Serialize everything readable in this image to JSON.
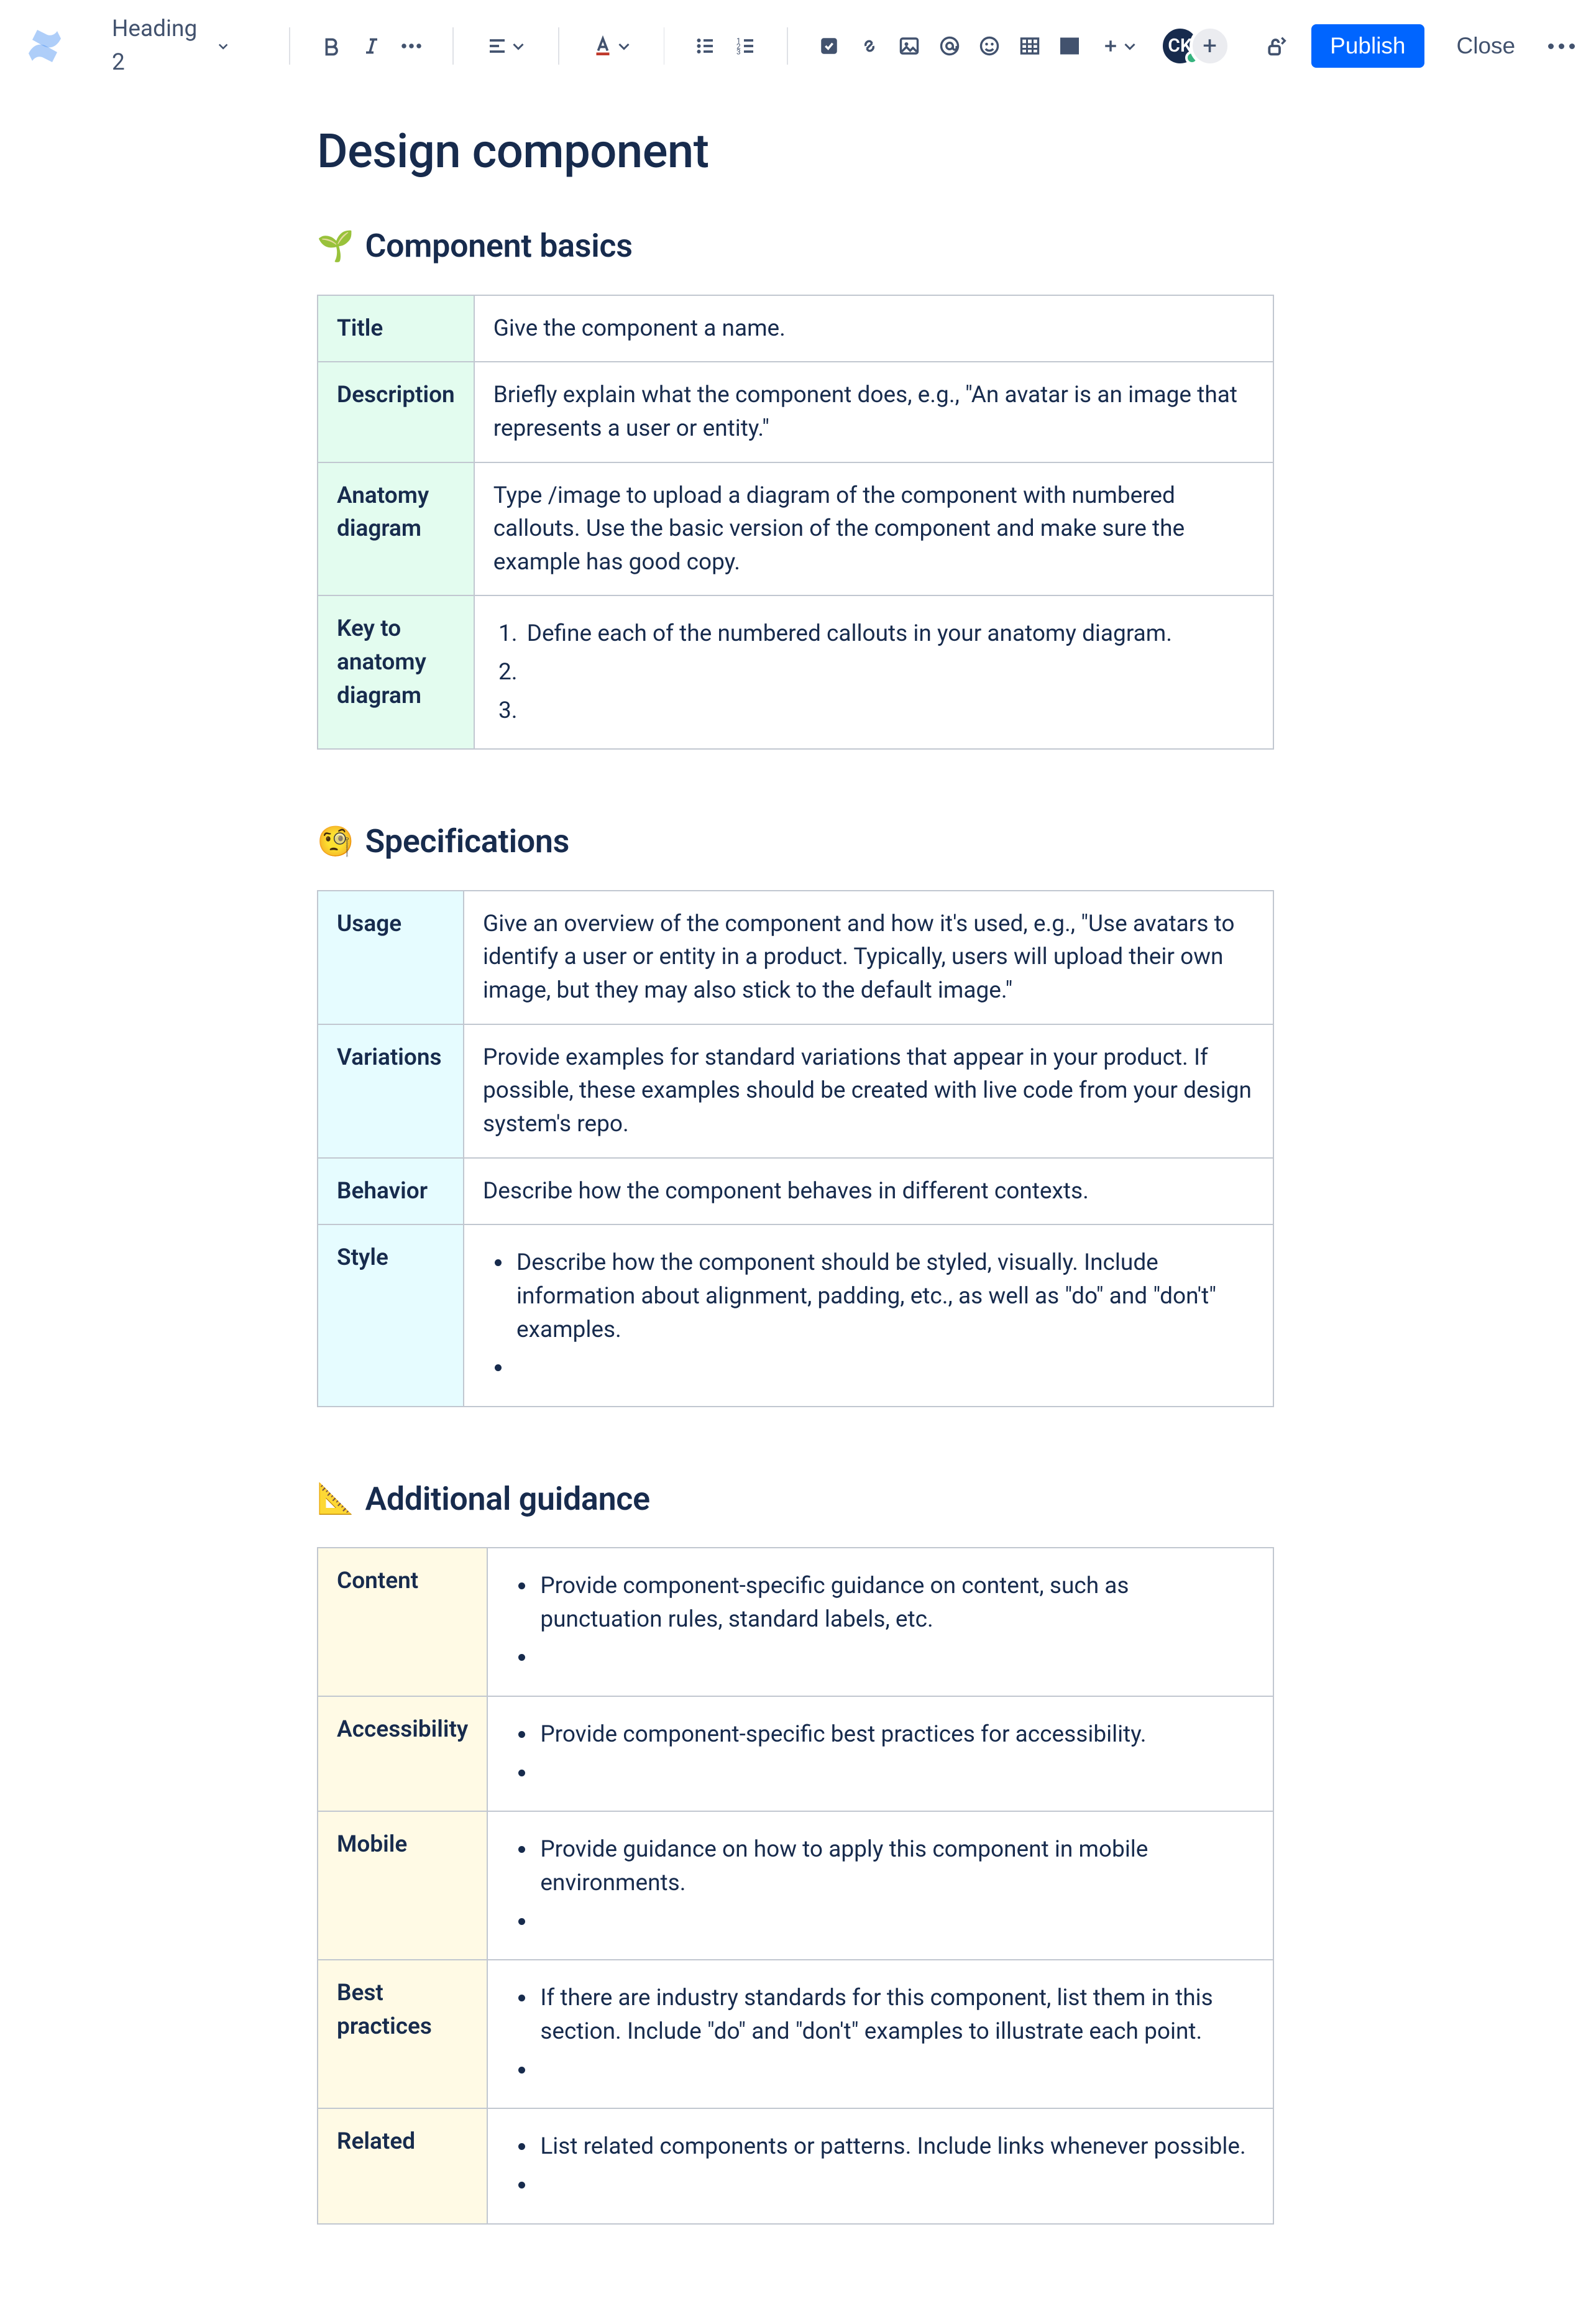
{
  "toolbar": {
    "text_style": "Heading 2",
    "publish_label": "Publish",
    "close_label": "Close",
    "avatar_initials": "CK"
  },
  "page": {
    "title": "Design component",
    "sections": {
      "basics": {
        "emoji": "🌱",
        "heading": "Component basics",
        "rows": {
          "title_label": "Title",
          "title_val": "Give the component a name.",
          "desc_label": "Description",
          "desc_val": "Briefly explain what the component does, e.g., \"An avatar is an image that represents a user or entity.\"",
          "anatomy_label": "Anatomy diagram",
          "anatomy_val": "Type /image to upload a diagram of the component with numbered callouts. Use the basic version of the component and make sure the example has good copy.",
          "key_label": "Key to anatomy diagram",
          "key_item1": "Define each of the numbered callouts in your anatomy diagram.",
          "key_item2": "",
          "key_item3": ""
        }
      },
      "specs": {
        "emoji": "🧐",
        "heading": "Specifications",
        "rows": {
          "usage_label": "Usage",
          "usage_val": "Give an overview of the component and how it's used, e.g., \"Use avatars to identify a user or entity in a product. Typically, users will upload their own image, but they may also stick to the default image.\"",
          "variations_label": "Variations",
          "variations_val": "Provide examples for standard variations that appear in your product. If possible, these examples should be created with live code from your design system's repo.",
          "behavior_label": "Behavior",
          "behavior_val": "Describe how the component behaves in different contexts.",
          "style_label": "Style",
          "style_item": "Describe how the component should be styled, visually. Include information about alignment, padding, etc., as well as \"do\" and \"don't\" examples."
        }
      },
      "guidance": {
        "emoji": "📐",
        "heading": "Additional guidance",
        "rows": {
          "content_label": "Content",
          "content_item": "Provide component-specific guidance on content, such as punctuation rules, standard labels, etc.",
          "a11y_label": "Accessibility",
          "a11y_item": "Provide component-specific best practices for accessibility.",
          "mobile_label": "Mobile",
          "mobile_item": "Provide guidance on how to apply this component in mobile environments.",
          "best_label": "Best practices",
          "best_item": "If there are industry standards for this component, list them in this section. Include \"do\" and \"don't\" examples to illustrate each point.",
          "related_label": "Related",
          "related_item": "List related components or patterns. Include links whenever possible."
        }
      }
    }
  }
}
